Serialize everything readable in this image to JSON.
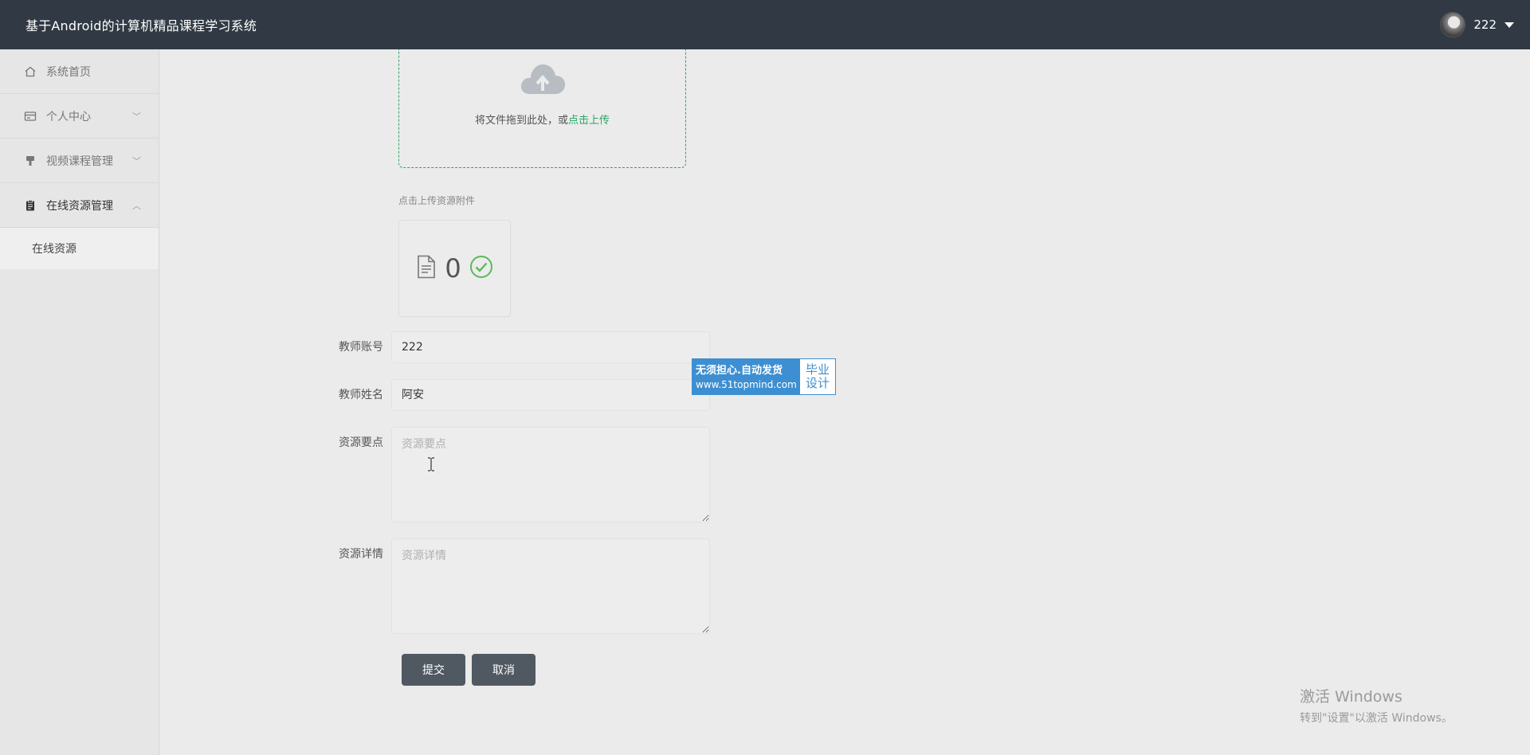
{
  "header": {
    "title": "基于Android的计算机精品课程学习系统",
    "username": "222"
  },
  "sidebar": {
    "items": [
      {
        "label": "系统首页",
        "icon": "home-icon"
      },
      {
        "label": "个人中心",
        "icon": "card-icon"
      },
      {
        "label": "视频课程管理",
        "icon": "brush-icon"
      },
      {
        "label": "在线资源管理",
        "icon": "clipboard-icon"
      }
    ],
    "sub_items": [
      {
        "label": "在线资源"
      }
    ]
  },
  "upload": {
    "hint_prefix": "将文件拖到此处，或",
    "hint_link": "点击上传",
    "attach_tip": "点击上传资源附件",
    "file_count": "0",
    "accent_color": "#29a565"
  },
  "form": {
    "teacher_account": {
      "label": "教师账号",
      "value": "222"
    },
    "teacher_name": {
      "label": "教师姓名",
      "value": "阿安"
    },
    "resource_points": {
      "label": "资源要点",
      "placeholder": "资源要点"
    },
    "resource_details": {
      "label": "资源详情",
      "placeholder": "资源详情"
    }
  },
  "buttons": {
    "submit": "提交",
    "cancel": "取消"
  },
  "watermark": {
    "line1": "无须担心.自动发货",
    "line2": "www.51topmind.com",
    "side": "毕业设计"
  },
  "os_overlay": {
    "line1": "激活 Windows",
    "line2": "转到\"设置\"以激活 Windows。"
  }
}
